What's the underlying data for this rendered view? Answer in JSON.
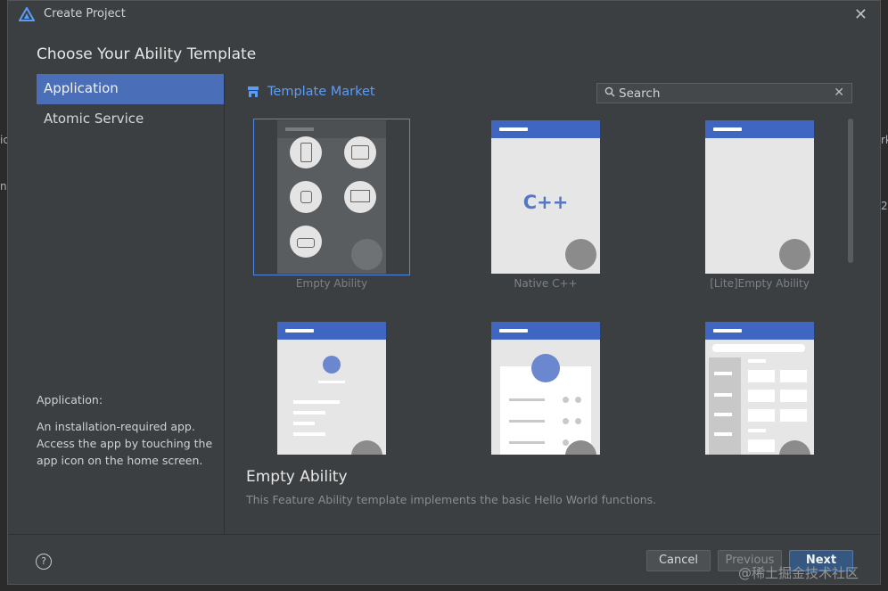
{
  "window": {
    "title": "Create Project"
  },
  "heading": "Choose Your Ability Template",
  "nav": {
    "items": [
      {
        "label": "Application",
        "selected": true
      },
      {
        "label": "Atomic Service",
        "selected": false
      }
    ]
  },
  "description": {
    "title": "Application:",
    "text": "An installation-required app. Access the app by touching the app icon on the home screen."
  },
  "market": {
    "label": "Template Market"
  },
  "search": {
    "placeholder": "Search"
  },
  "templates": [
    {
      "label": "Empty Ability"
    },
    {
      "label": "Native C++",
      "glyph": "C++"
    },
    {
      "label": "[Lite]Empty Ability"
    }
  ],
  "selected_template": {
    "title": "Empty Ability",
    "description": "This Feature Ability template implements the basic Hello World functions."
  },
  "buttons": {
    "cancel": "Cancel",
    "previous": "Previous",
    "next": "Next",
    "help": "?"
  },
  "watermark": "@稀土掘金技术社区",
  "edge_fragments": {
    "left_1": "ic",
    "left_2": "n",
    "right_1": "rk",
    "right_2": "2("
  },
  "colors": {
    "accent": "#4a6eb8",
    "link": "#5c9cf5",
    "header_blue": "#3f67c2"
  },
  "icons": [
    "app-logo-icon",
    "close-icon",
    "store-icon",
    "search-icon",
    "clear-icon",
    "help-icon"
  ]
}
